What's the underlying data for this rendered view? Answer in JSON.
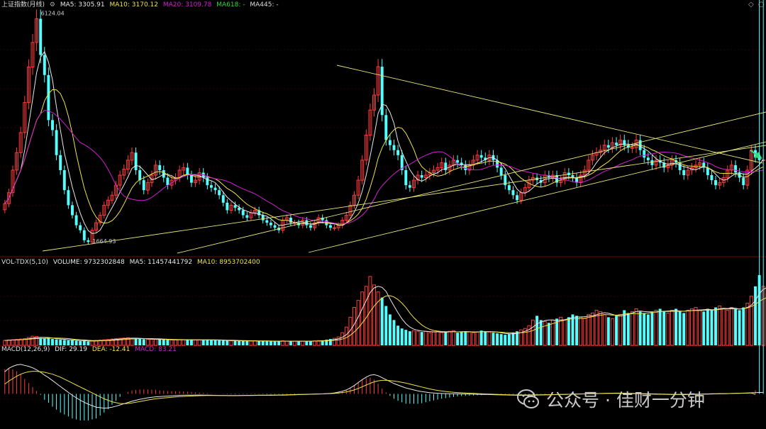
{
  "colors": {
    "up": "#ff3b3b",
    "down": "#54ffff",
    "ma5": "#e8e8e8",
    "ma10": "#f0e24a",
    "ma20": "#d020d0",
    "trendline": "#e6e67a",
    "grid": "#5a0000",
    "axis": "#7a0000",
    "dif": "#e8e8e8",
    "dea": "#f0e24a"
  },
  "price_header": {
    "title": "上证指数(月线)",
    "ma5": "MA5: 3305.91",
    "ma10": "MA10: 3170.12",
    "ma20": "MA20: 3109.78",
    "ma618": "MA618: -",
    "ma445": "MA445: -"
  },
  "volume_header": {
    "title": "VOL-TDX(5,10)",
    "volume": "VOLUME: 9732302848",
    "ma5": "MA5: 11457441792",
    "ma10": "MA10: 8953702400"
  },
  "macd_header": {
    "title": "MACD(12,26,9)",
    "dif": "DIF: 29.19",
    "dea": "DEA: -12.41",
    "macd": "MACD: 83.21"
  },
  "annotations": {
    "high": "6124.04",
    "low": "1664.93"
  },
  "watermark": "公众号 · 佳财一分钟",
  "chart_data": {
    "type": "candlestick-monthly",
    "title": "上证指数(月线)",
    "price_range": [
      1400,
      6300
    ],
    "labeled_points": {
      "high": 6124.04,
      "low": 1664.93
    },
    "price_series": [
      2430,
      2650,
      3100,
      3450,
      3850,
      4450,
      5160,
      5650,
      6124.04,
      5400,
      5000,
      4100,
      3900,
      3400,
      3100,
      2700,
      2400,
      2200,
      2000,
      1900,
      1700,
      1664.93,
      1900,
      2050,
      2200,
      2400,
      2500,
      2600,
      2800,
      3000,
      3120,
      3300,
      3450,
      3100,
      2900,
      2700,
      2850,
      3000,
      3200,
      3100,
      2950,
      2800,
      2900,
      2950,
      3100,
      3150,
      3000,
      2850,
      2900,
      3050,
      2950,
      2800,
      2750,
      2700,
      2600,
      2450,
      2300,
      2400,
      2350,
      2300,
      2200,
      2150,
      2250,
      2300,
      2200,
      2100,
      2050,
      2000,
      1950,
      1900,
      2100,
      2150,
      2050,
      2050,
      2000,
      2100,
      2000,
      1950,
      2050,
      2150,
      2100,
      2000,
      1950,
      1950,
      2000,
      2100,
      2200,
      2400,
      2600,
      2900,
      3300,
      3800,
      4300,
      4600,
      5166,
      4200,
      3700,
      3600,
      3500,
      3400,
      3100,
      2800,
      2750,
      2900,
      3000,
      2950,
      3000,
      3050,
      3100,
      3150,
      3250,
      3100,
      3200,
      3300,
      3250,
      3200,
      3100,
      3200,
      3300,
      3400,
      3350,
      3300,
      3400,
      3300,
      3150,
      3000,
      2800,
      2700,
      2600,
      2500,
      2650,
      2750,
      2900,
      2950,
      2900,
      2850,
      3000,
      2950,
      3000,
      2850,
      2900,
      3050,
      3000,
      2950,
      2850,
      3000,
      3100,
      3300,
      3400,
      3450,
      3500,
      3600,
      3550,
      3650,
      3600,
      3700,
      3600,
      3550,
      3550,
      3700,
      3500,
      3350,
      3300,
      3200,
      3300,
      3250,
      3150,
      3200,
      3300,
      3250,
      3100,
      3000,
      3100,
      3150,
      3200,
      3250,
      3150,
      3000,
      2900,
      2800,
      2850,
      2950,
      3100,
      3200,
      3050,
      2950,
      2800,
      3100,
      3500,
      3350,
      3300,
      3305.91
    ],
    "volume_range": [
      0,
      5500
    ],
    "volume_series": [
      350,
      380,
      400,
      420,
      450,
      480,
      560,
      650,
      620,
      520,
      480,
      500,
      450,
      420,
      400,
      380,
      350,
      360,
      330,
      300,
      320,
      280,
      300,
      350,
      380,
      400,
      420,
      450,
      480,
      500,
      520,
      540,
      500,
      480,
      460,
      440,
      420,
      430,
      420,
      410,
      400,
      390,
      380,
      390,
      400,
      410,
      400,
      390,
      380,
      390,
      400,
      380,
      370,
      360,
      350,
      340,
      330,
      320,
      330,
      320,
      310,
      300,
      310,
      320,
      310,
      300,
      290,
      300,
      290,
      280,
      320,
      300,
      290,
      300,
      310,
      300,
      290,
      300,
      320,
      340,
      360,
      400,
      450,
      500,
      600,
      900,
      1300,
      2000,
      2700,
      3200,
      3800,
      4200,
      4900,
      4300,
      3800,
      3400,
      2800,
      2200,
      1800,
      1400,
      1200,
      1100,
      1000,
      1050,
      1000,
      950,
      1000,
      900,
      950,
      1000,
      900,
      950,
      1000,
      1050,
      900,
      950,
      1000,
      950,
      900,
      950,
      1050,
      1000,
      950,
      900,
      850,
      800,
      750,
      800,
      900,
      1000,
      1100,
      1200,
      1400,
      1800,
      2100,
      1800,
      1700,
      1600,
      1800,
      1900,
      2000,
      1800,
      2000,
      2200,
      2100,
      2000,
      1900,
      2200,
      2300,
      2500,
      2400,
      2200,
      2000,
      1900,
      2100,
      2200,
      2500,
      2300,
      2400,
      2600,
      2400,
      2300,
      2200,
      2400,
      2500,
      2600,
      2400,
      2300,
      2500,
      2600,
      2400,
      2300,
      2500,
      2600,
      2700,
      2500,
      2400,
      2600,
      2500,
      2700,
      2800,
      2600,
      2500,
      2700,
      2600,
      2500,
      2700,
      3000,
      3500,
      4200,
      5000,
      4200,
      3700,
      3600,
      3200
    ],
    "macd_range": [
      -700,
      800
    ],
    "dif_series": [
      450,
      520,
      560,
      590,
      600,
      580,
      560,
      530,
      490,
      440,
      380,
      330,
      270,
      210,
      150,
      90,
      30,
      -30,
      -80,
      -130,
      -170,
      -210,
      -240,
      -270,
      -280,
      -290,
      -285,
      -270,
      -250,
      -225,
      -200,
      -175,
      -150,
      -130,
      -110,
      -95,
      -80,
      -70,
      -60,
      -55,
      -50,
      -45,
      -40,
      -35,
      -30,
      -28,
      -26,
      -25,
      -24,
      -24,
      -25,
      -26,
      -28,
      -30,
      -32,
      -34,
      -35,
      -36,
      -36,
      -35,
      -34,
      -33,
      -32,
      -31,
      -30,
      -30,
      -30,
      -29,
      -28,
      -27,
      -25,
      -23,
      -20,
      -18,
      -15,
      -12,
      -10,
      -8,
      -5,
      -2,
      0,
      5,
      10,
      20,
      35,
      55,
      80,
      120,
      170,
      230,
      290,
      340,
      380,
      390,
      370,
      330,
      290,
      250,
      210,
      180,
      150,
      120,
      100,
      80,
      60,
      45,
      35,
      25,
      18,
      12,
      8,
      5,
      3,
      2,
      1,
      0,
      -2,
      -4,
      -6,
      -8,
      -10,
      -12,
      -14,
      -16,
      -18,
      -20,
      -22,
      -24,
      -26,
      -28,
      -30,
      -30,
      -28,
      -26,
      -24,
      -22,
      -20,
      -18,
      -16,
      -14,
      -12,
      -10,
      -8,
      -6,
      -4,
      -2,
      0,
      2,
      4,
      6,
      8,
      10,
      12,
      14,
      16,
      15,
      14,
      12,
      10,
      8,
      6,
      4,
      2,
      0,
      -2,
      -4,
      -6,
      -8,
      -10,
      -12,
      -14,
      -16,
      -14,
      -12,
      -10,
      -8,
      -6,
      -4,
      -2,
      0,
      2,
      4,
      6,
      8,
      10,
      12,
      15,
      18,
      22,
      25,
      28,
      29.19
    ],
    "dea_series": [
      200,
      260,
      310,
      360,
      400,
      430,
      450,
      460,
      460,
      450,
      440,
      420,
      400,
      370,
      340,
      300,
      260,
      220,
      180,
      140,
      100,
      60,
      20,
      -20,
      -60,
      -100,
      -130,
      -160,
      -180,
      -195,
      -200,
      -195,
      -185,
      -170,
      -155,
      -140,
      -125,
      -112,
      -100,
      -90,
      -82,
      -75,
      -68,
      -62,
      -57,
      -52,
      -48,
      -44,
      -40,
      -37,
      -35,
      -33,
      -32,
      -32,
      -32,
      -32,
      -32,
      -32,
      -32,
      -32,
      -31,
      -30,
      -29,
      -28,
      -27,
      -26,
      -25,
      -24,
      -23,
      -22,
      -20,
      -18,
      -16,
      -14,
      -12,
      -10,
      -8,
      -6,
      -4,
      -2,
      0,
      2,
      5,
      10,
      18,
      28,
      40,
      58,
      80,
      110,
      145,
      180,
      215,
      245,
      265,
      275,
      275,
      270,
      260,
      250,
      235,
      220,
      200,
      180,
      160,
      140,
      120,
      100,
      85,
      70,
      58,
      48,
      40,
      33,
      27,
      22,
      18,
      14,
      10,
      6,
      2,
      -2,
      -5,
      -8,
      -11,
      -14,
      -17,
      -19,
      -21,
      -22,
      -22,
      -22,
      -21,
      -20,
      -19,
      -18,
      -17,
      -16,
      -15,
      -14,
      -12,
      -10,
      -8,
      -6,
      -4,
      -2,
      0,
      2,
      4,
      6,
      7,
      8,
      9,
      9,
      9,
      8,
      7,
      6,
      5,
      3,
      1,
      -1,
      -3,
      -5,
      -7,
      -8,
      -9,
      -10,
      -10,
      -10,
      -9,
      -8,
      -7,
      -6,
      -5,
      -4,
      -2,
      0,
      2,
      4,
      5,
      6,
      7,
      8,
      10,
      12,
      14,
      16,
      18,
      -12.41
    ]
  }
}
